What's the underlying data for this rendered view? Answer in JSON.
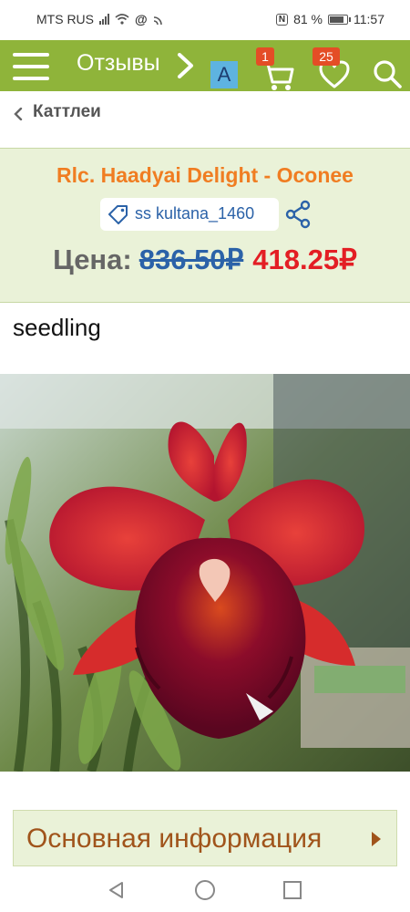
{
  "status_bar": {
    "carrier": "MTS RUS",
    "battery": "81 %",
    "time": "11:57"
  },
  "header": {
    "menu_icon": "hamburger-icon",
    "title": "Отзывы",
    "a_label": "A",
    "cart_count": "1",
    "favorites_count": "25",
    "accent_color": "#8fb43a"
  },
  "breadcrumb": {
    "label": "Каттлеи"
  },
  "product": {
    "title": "Rlc. Haadyai Delight - Oconee",
    "tag": "ss kultana_1460",
    "price_label": "Цена:",
    "old_price": "836.50₽",
    "new_price": "418.25₽",
    "description": "seedling"
  },
  "section": {
    "title": "Основная информация"
  },
  "colors": {
    "title_orange": "#f07d22",
    "price_red": "#e31e24",
    "link_blue": "#2b62a8",
    "badge": "#e44d26"
  }
}
